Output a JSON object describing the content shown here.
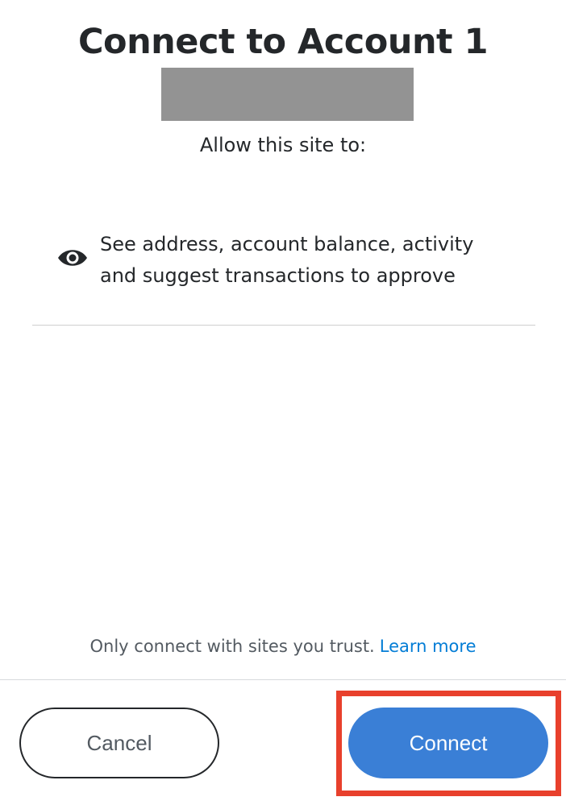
{
  "header": {
    "title": "Connect to Account 1"
  },
  "prompt": {
    "allow_text": "Allow this site to:"
  },
  "permissions": [
    {
      "icon": "eye-icon",
      "line1": "See address, account balance, activity",
      "line2": "and suggest transactions to approve"
    }
  ],
  "footer": {
    "trust_text": "Only connect with sites you trust.",
    "learn_more": "Learn more"
  },
  "actions": {
    "cancel_label": "Cancel",
    "connect_label": "Connect"
  },
  "colors": {
    "primary": "#3a7fd6",
    "link": "#037dd6",
    "highlight": "#e8402c",
    "redaction": "#939393"
  }
}
